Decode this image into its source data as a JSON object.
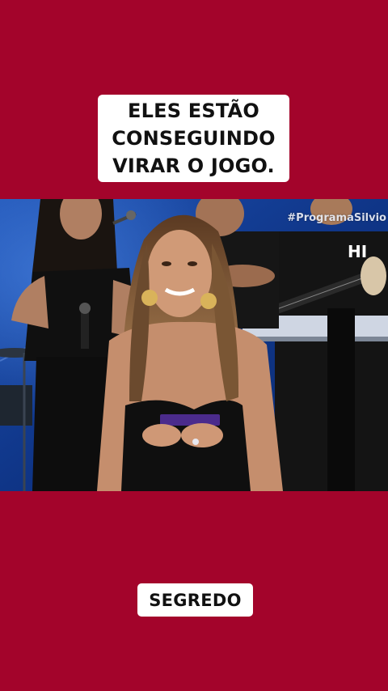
{
  "caption_top": {
    "line1": "ELES ESTÃO",
    "line2": "CONSEGUINDO",
    "line3": "VIRAR O JOGO."
  },
  "video": {
    "hashtag": "#ProgramaSilvio"
  },
  "caption_bottom": {
    "text": "SEGREDO"
  },
  "colors": {
    "background": "#a3042b",
    "caption_box": "#ffffff",
    "caption_text": "#111111",
    "stage_blue": "#123a88"
  }
}
